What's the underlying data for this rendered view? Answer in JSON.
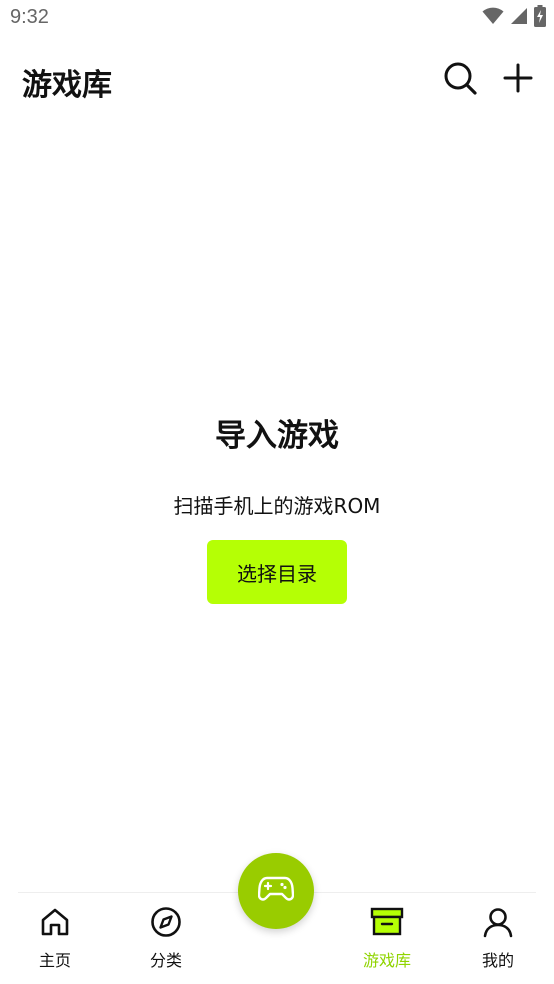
{
  "status_bar": {
    "time": "9:32",
    "icons": [
      "wifi-icon",
      "signal-icon",
      "battery-charging-icon"
    ]
  },
  "header": {
    "title": "游戏库",
    "actions": [
      "search-icon",
      "plus-icon"
    ]
  },
  "empty_state": {
    "title": "导入游戏",
    "description": "扫描手机上的游戏ROM",
    "button_label": "选择目录"
  },
  "bottom_nav": {
    "items": [
      {
        "label": "主页",
        "icon": "home-icon",
        "active": false
      },
      {
        "label": "分类",
        "icon": "compass-icon",
        "active": false
      },
      {
        "label": "游戏库",
        "icon": "archive-box-icon",
        "active": true
      },
      {
        "label": "我的",
        "icon": "user-icon",
        "active": false
      }
    ],
    "center_button_icon": "gamepad-icon"
  },
  "colors": {
    "accent": "#b5ff05",
    "active_label": "#8fd400",
    "fab": "#99cc00"
  }
}
